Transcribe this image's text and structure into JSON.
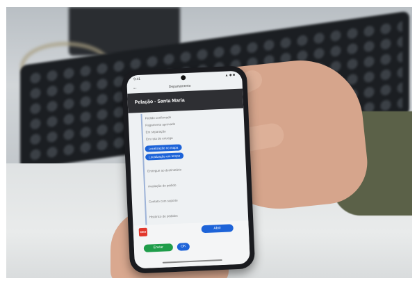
{
  "scene": {
    "phone_app": {
      "status_time": "9:41",
      "status_icons": "▲ ◆ ■",
      "top_label": "Departamento",
      "header_title": "Pelação - Santa Maria",
      "header_subtitle": "",
      "timeline": [
        {
          "text": "Pedido confirmado"
        },
        {
          "text": "Pagamento aprovado"
        },
        {
          "text": "Em separação"
        },
        {
          "text": "Em rota de entrega"
        }
      ],
      "action_pills": [
        "Localização no mapa",
        "Localização em tempo"
      ],
      "more_rows": [
        "Entregue ao destinatário",
        "Avaliação do pedido",
        "Contato com suporte",
        "Histórico de pedidos"
      ],
      "brand_logo_text": "CEU",
      "primary_action": "Abrir",
      "green_button": "Enviar",
      "blue_button": "OK"
    },
    "colors": {
      "accent_blue": "#1d63d8",
      "green": "#1f9d4a",
      "header_dark": "#2e2f33"
    }
  }
}
